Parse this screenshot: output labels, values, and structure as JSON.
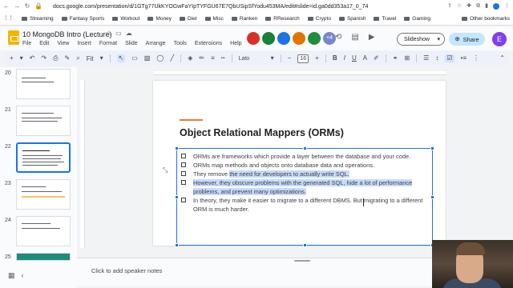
{
  "browser": {
    "url": "docs.google.com/presentation/d/1GTg77UkKYOGwFaYIpTYFGU67E7QbUSipSfYodu453MA/edit#slide=id.ga0dd353a17_0_74",
    "bookmarks": [
      "Streaming",
      "Fantasy Sports",
      "Workout",
      "Money",
      "Diet",
      "Misc",
      "Ranken",
      "RResearch",
      "Crypto",
      "Spanish",
      "Travel",
      "Gaming"
    ],
    "other_bookmarks": "Other bookmarks"
  },
  "app": {
    "doc_title": "10 MongoDB Intro (Lecture)",
    "menu": [
      "File",
      "Edit",
      "View",
      "Insert",
      "Format",
      "Slide",
      "Arrange",
      "Tools",
      "Extensions",
      "Help"
    ],
    "collaborator_count": "+4",
    "slideshow_label": "Slideshow",
    "share_label": "Share",
    "user_initial": "E",
    "collaborator_colors": [
      "#d93025",
      "#188038",
      "#1a73e8",
      "#e37400",
      "#1e8e3e",
      "#7986cb"
    ]
  },
  "toolbar": {
    "zoom": "Fit",
    "font": "Lato",
    "font_size": "16"
  },
  "filmstrip": {
    "slides": [
      {
        "number": "20"
      },
      {
        "number": "21"
      },
      {
        "number": "22"
      },
      {
        "number": "23"
      },
      {
        "number": "24"
      },
      {
        "number": "25"
      }
    ]
  },
  "slide": {
    "title": "Object Relational Mappers (ORMs)",
    "bullets": [
      {
        "text": "ORMs are frameworks which provide a layer between the database and your code."
      },
      {
        "text": "ORMs map methods and objects onto database data and operations."
      },
      {
        "pre": "They remove ",
        "selected": "the need for developers to actually write SQL."
      },
      {
        "selected": "However, they obscure problems with the generated SQL, hide a lot of performance problems, and prevent many optimizations."
      },
      {
        "text": "In theory, they make it easier to migrate to a different DBMS. But migrating to a different ORM is much harder."
      }
    ]
  },
  "notes": {
    "placeholder": "Click to add speaker notes"
  },
  "colors": {
    "accent": "#e57b3a",
    "selection": "#c6dafc",
    "focus": "#1a73e8"
  }
}
